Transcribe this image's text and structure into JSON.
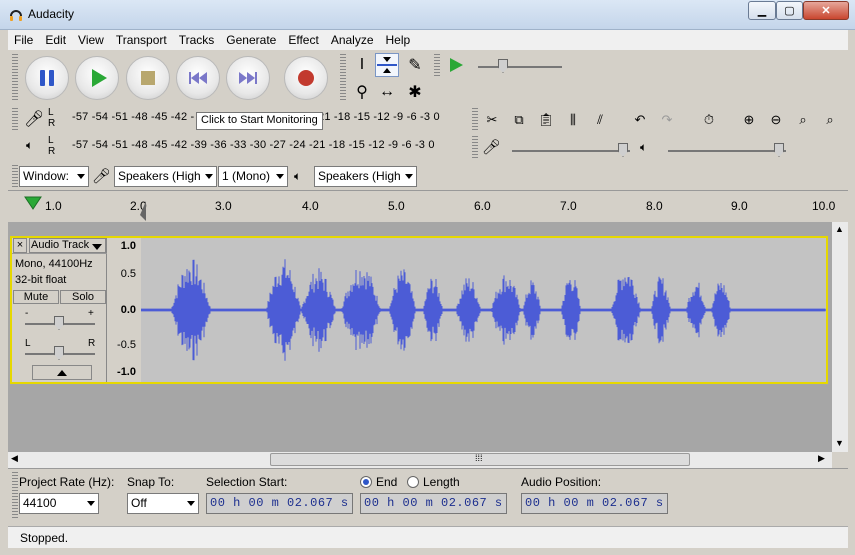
{
  "window": {
    "title": "Audacity"
  },
  "menu": [
    "File",
    "Edit",
    "View",
    "Transport",
    "Tracks",
    "Generate",
    "Effect",
    "Analyze",
    "Help"
  ],
  "meters": {
    "record_scale": "-57 -54 -51 -48 -45 -42 -",
    "record_scale_tail": "21 -18 -15 -12  -9  -6  -3  0",
    "play_scale": "-57 -54 -51 -48 -45 -42 -39 -36 -33 -30 -27 -24 -21 -18 -15 -12  -9  -6  -3  0",
    "l": "L",
    "r": "R",
    "tooltip": "Click to Start Monitoring"
  },
  "device": {
    "host": "Window:",
    "output_device": "Speakers (High",
    "channels": "1 (Mono)",
    "input_device": "Speakers (High"
  },
  "timeline": {
    "ticks": [
      "1.0",
      "2.0",
      "3.0",
      "4.0",
      "5.0",
      "6.0",
      "7.0",
      "8.0",
      "9.0",
      "10.0"
    ]
  },
  "track": {
    "name": "Audio Track",
    "close": "×",
    "format_line1": "Mono, 44100Hz",
    "format_line2": "32-bit float",
    "mute": "Mute",
    "solo": "Solo",
    "gain_minus": "-",
    "gain_plus": "+",
    "pan_l": "L",
    "pan_r": "R",
    "yscale": [
      "1.0",
      "0.5",
      "0.0",
      "-0.5",
      "-1.0"
    ]
  },
  "scroll": {
    "grip": "⁞⁞⁞"
  },
  "selection_toolbar": {
    "project_rate_label": "Project Rate (Hz):",
    "project_rate": "44100",
    "snap_label": "Snap To:",
    "snap": "Off",
    "selection_start_label": "Selection Start:",
    "end_label": "End",
    "length_label": "Length",
    "audio_position_label": "Audio Position:",
    "selection_start": "00 h 00 m 02.067 s",
    "end": "00 h 00 m 02.067 s",
    "audio_position": "00 h 00 m 02.067 s"
  },
  "status": "Stopped.",
  "colors": {
    "waveform": "#4c5cd6",
    "track_border": "#e6d800",
    "play": "#2aa836",
    "record": "#c23a2e",
    "pause": "#2f57c8"
  }
}
